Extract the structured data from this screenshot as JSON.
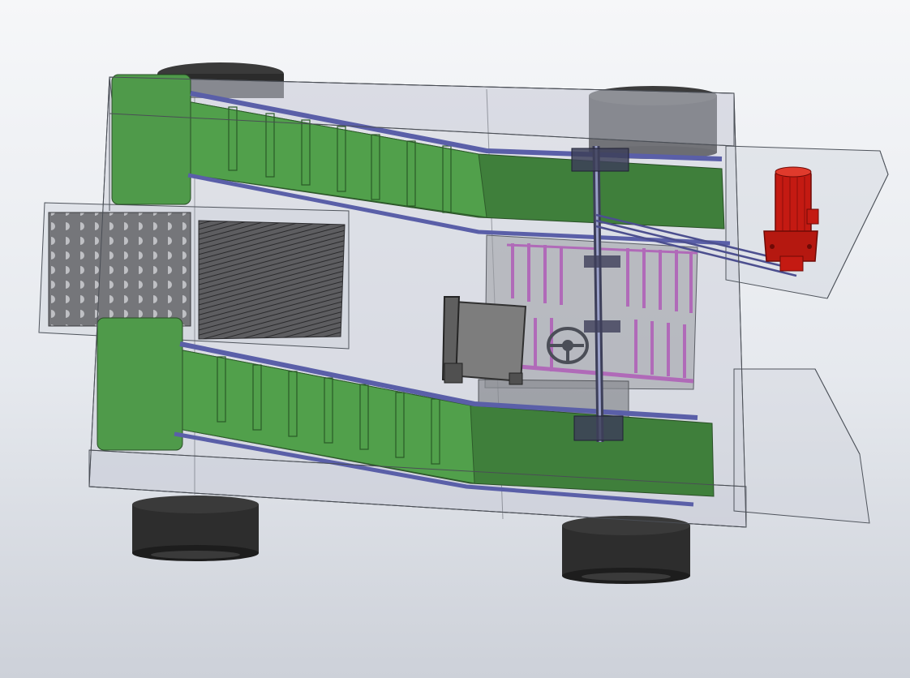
{
  "viewport": {
    "background": [
      "#f6f7f9",
      "#cdd1d9"
    ]
  },
  "colors": {
    "frame_glass": "#c9cdd6",
    "frame_edge": "#4f545c",
    "conveyor_green": "#4f9a4a",
    "conveyor_dark": "#3f7f3b",
    "rail_blue": "#5a5fa8",
    "roller_pink": "#b06ab8",
    "motor_red": "#c41a12",
    "tire": "#2d2d2d",
    "seat": "#7d7d7d",
    "sieve": "#6f6f73"
  },
  "parts": {
    "frame": "transparent-chassis-frame",
    "upper_conveyor": "upper-belt-conveyor",
    "lower_conveyor": "lower-belt-conveyor",
    "sieve_plate": "perforated-sieve-plate",
    "mesh": "mesh-screen",
    "roller_rack": "picking-roller-rack",
    "seat": "operator-seat",
    "steering_wheel": "steering-wheel",
    "motor": "drive-motor",
    "shaft": "drive-shaft",
    "wheels": [
      "wheel-front-left",
      "wheel-front-right",
      "wheel-rear-left",
      "wheel-rear-right"
    ]
  }
}
